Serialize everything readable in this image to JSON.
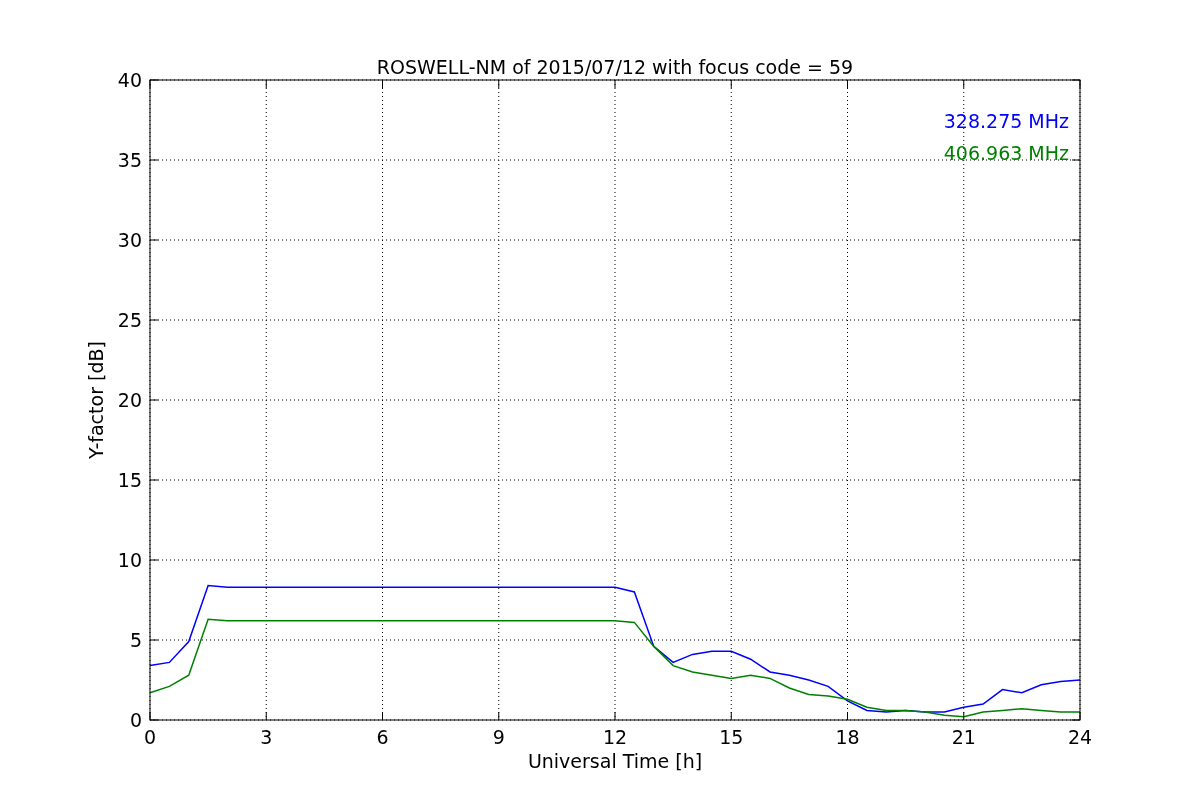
{
  "figure": {
    "chart_data": {
      "type": "line",
      "grid": true,
      "title": "ROSWELL-NM of 2015/07/12 with focus code = 59",
      "xlabel": "Universal Time [h]",
      "ylabel": "Y-factor [dB]",
      "xlim": [
        0,
        24
      ],
      "ylim": [
        0,
        40
      ],
      "xticks": [
        0,
        3,
        6,
        9,
        12,
        15,
        18,
        21,
        24
      ],
      "yticks": [
        0,
        5,
        10,
        15,
        20,
        25,
        30,
        35,
        40
      ],
      "x": [
        0,
        0.5,
        1,
        1.5,
        2,
        2.5,
        3,
        3.5,
        4,
        4.5,
        5,
        5.5,
        6,
        6.5,
        7,
        7.5,
        8,
        8.5,
        9,
        9.5,
        10,
        10.5,
        11,
        11.5,
        12,
        12.5,
        13,
        13.5,
        14,
        14.5,
        15,
        15.5,
        16,
        16.5,
        17,
        17.5,
        18,
        18.5,
        19,
        19.5,
        20,
        20.5,
        21,
        21.5,
        22,
        22.5,
        23,
        23.5,
        24
      ],
      "series": [
        {
          "name": "328.275 MHz",
          "color": "#0000ff",
          "values": [
            3.4,
            3.6,
            4.9,
            8.4,
            8.3,
            8.3,
            8.3,
            8.3,
            8.3,
            8.3,
            8.3,
            8.3,
            8.3,
            8.3,
            8.3,
            8.3,
            8.3,
            8.3,
            8.3,
            8.3,
            8.3,
            8.3,
            8.3,
            8.3,
            8.3,
            8.0,
            4.6,
            3.6,
            4.1,
            4.3,
            4.3,
            3.8,
            3.0,
            2.8,
            2.5,
            2.1,
            1.2,
            0.6,
            0.5,
            0.6,
            0.5,
            0.5,
            0.8,
            1.0,
            1.9,
            1.7,
            2.2,
            2.4,
            2.5
          ]
        },
        {
          "name": "406.963 MHz",
          "color": "#008000",
          "values": [
            1.7,
            2.1,
            2.8,
            6.3,
            6.2,
            6.2,
            6.2,
            6.2,
            6.2,
            6.2,
            6.2,
            6.2,
            6.2,
            6.2,
            6.2,
            6.2,
            6.2,
            6.2,
            6.2,
            6.2,
            6.2,
            6.2,
            6.2,
            6.2,
            6.2,
            6.1,
            4.6,
            3.4,
            3.0,
            2.8,
            2.6,
            2.8,
            2.6,
            2.0,
            1.6,
            1.5,
            1.3,
            0.8,
            0.6,
            0.6,
            0.5,
            0.3,
            0.2,
            0.5,
            0.6,
            0.7,
            0.6,
            0.5,
            0.5
          ]
        }
      ]
    }
  }
}
